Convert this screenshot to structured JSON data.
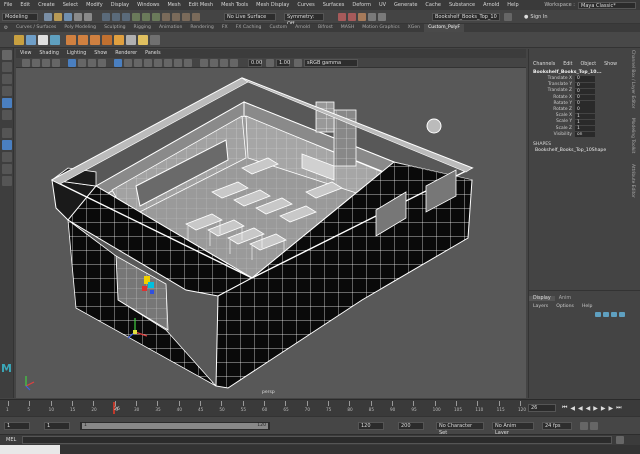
{
  "menubar": {
    "items": [
      "File",
      "Edit",
      "Create",
      "Select",
      "Modify",
      "Display",
      "Windows",
      "Mesh",
      "Edit Mesh",
      "Mesh Tools",
      "Mesh Display",
      "Curves",
      "Surfaces",
      "Deform",
      "UV",
      "Generate",
      "Cache",
      "Substance",
      "Arnold",
      "Help"
    ],
    "workspace_label": "Workspace :",
    "workspace_value": "Maya Classic*"
  },
  "statusline": {
    "mode": "Modeling",
    "live_surface": "No Live Surface",
    "symmetry": "Symmetry: Off",
    "object_name": "Bookshelf_Books_Top_10",
    "signin": "Sign In"
  },
  "shelf": {
    "tabs": [
      "Curves / Surfaces",
      "Poly Modeling",
      "Sculpting",
      "Rigging",
      "Animation",
      "Rendering",
      "FX",
      "FX Caching",
      "Custom",
      "Arnold",
      "Bifrost",
      "MASH",
      "Motion Graphics",
      "XGen",
      "Custom_PolyF"
    ],
    "active_tab": 14
  },
  "viewport": {
    "menus": [
      "View",
      "Shading",
      "Lighting",
      "Show",
      "Renderer",
      "Panels"
    ],
    "exposure": "0.00",
    "gamma": "1.00",
    "colorspace": "sRGB gamma",
    "camera_label": "persp"
  },
  "channelbox": {
    "tabs": [
      "Channels",
      "Edit",
      "Object",
      "Show"
    ],
    "object_name": "Bookshelf_Books_Top_10...",
    "attributes": [
      {
        "name": "Translate X",
        "value": "0"
      },
      {
        "name": "Translate Y",
        "value": "0"
      },
      {
        "name": "Translate Z",
        "value": "0"
      },
      {
        "name": "Rotate X",
        "value": "0"
      },
      {
        "name": "Rotate Y",
        "value": "0"
      },
      {
        "name": "Rotate Z",
        "value": "0"
      },
      {
        "name": "Scale X",
        "value": "1"
      },
      {
        "name": "Scale Y",
        "value": "1"
      },
      {
        "name": "Scale Z",
        "value": "1"
      },
      {
        "name": "Visibility",
        "value": "on"
      }
    ],
    "shapes_header": "SHAPES",
    "shape_name": "Bookshelf_Books_Top_10Shape"
  },
  "layer_editor": {
    "tabs": [
      "Display",
      "Anim"
    ],
    "menus": [
      "Layers",
      "Options",
      "Help"
    ]
  },
  "side_tabs": [
    "Channel Box / Layer Editor",
    "Modeling Toolkit",
    "Attribute Editor"
  ],
  "timeline": {
    "ticks": [
      "1",
      "5",
      "10",
      "15",
      "20",
      "25",
      "30",
      "35",
      "40",
      "45",
      "50",
      "55",
      "60",
      "65",
      "70",
      "75",
      "80",
      "85",
      "90",
      "95",
      "100",
      "105",
      "110",
      "115",
      "120"
    ],
    "current_frame": "26",
    "current_frame_field": "26"
  },
  "rangebar": {
    "start": "1",
    "start_inner": "1",
    "range_start": "1",
    "range_end": "120",
    "end_inner": "120",
    "end": "200",
    "character_set": "No Character Set",
    "anim_layer": "No Anim Layer",
    "fps": "24 fps"
  },
  "cmdline": {
    "label": "MEL"
  },
  "colors": {
    "accent": "#5285a6",
    "frame_red": "#c0392b"
  }
}
